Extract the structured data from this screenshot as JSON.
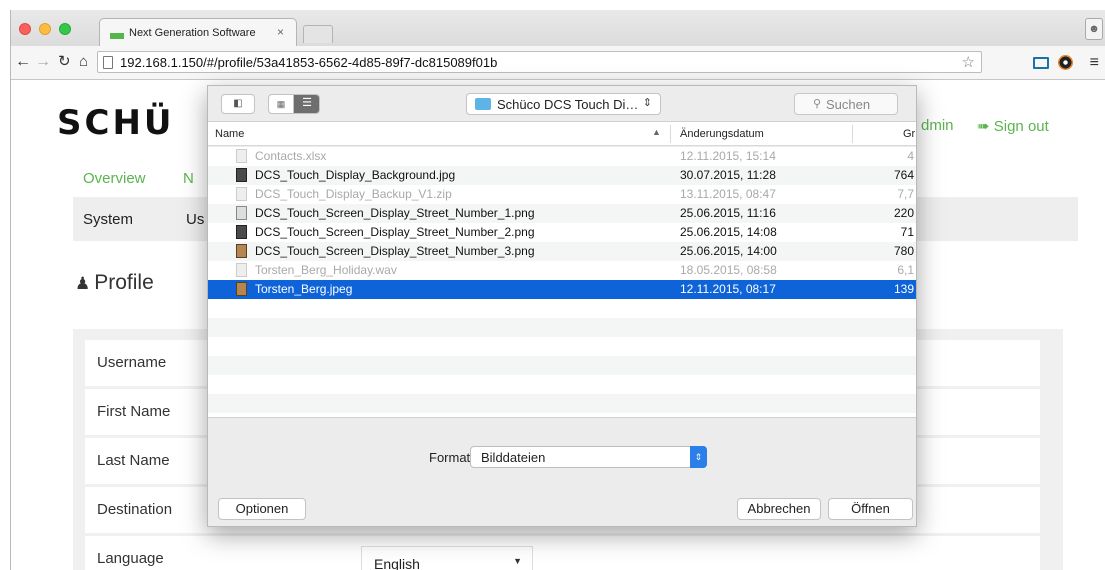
{
  "browser": {
    "tab_title": "Next Generation Software",
    "tab_close": "×",
    "url": "192.168.1.150/#/profile/53a41853-6562-4d85-89f7-dc815089f01b",
    "icons": [
      "back-arrow-icon",
      "forward-arrow-icon",
      "reload-icon",
      "home-icon",
      "page-icon",
      "star-icon",
      "extension-icon",
      "chrome-menu-icon",
      "profile-icon"
    ]
  },
  "page": {
    "logo": "SCHÜ",
    "admin_link": "dmin",
    "signout_label": "Sign out",
    "nav": {
      "overview": "Overview",
      "next": "N"
    },
    "subnav": {
      "system": "System",
      "users": "Us"
    },
    "profile_heading": "Profile",
    "form": {
      "username_label": "Username",
      "first_name_label": "First Name",
      "last_name_label": "Last Name",
      "destination_label": "Destination",
      "language_label": "Language",
      "language_value": "English"
    },
    "accent_color": "#5bb44e"
  },
  "dialog": {
    "location": "Schüco DCS Touch Di…",
    "search_placeholder": "Suchen",
    "columns": {
      "name": "Name",
      "date": "Änderungsdatum",
      "size": "Gr"
    },
    "files": [
      {
        "name": "Contacts.xlsx",
        "date": "12.11.2015, 15:14",
        "size": "4",
        "state": "disabled"
      },
      {
        "name": "DCS_Touch_Display_Background.jpg",
        "date": "30.07.2015, 11:28",
        "size": "764",
        "state": "enabled"
      },
      {
        "name": "DCS_Touch_Display_Backup_V1.zip",
        "date": "13.11.2015, 08:47",
        "size": "7,7",
        "state": "disabled"
      },
      {
        "name": "DCS_Touch_Screen_Display_Street_Number_1.png",
        "date": "25.06.2015, 11:16",
        "size": "220",
        "state": "enabled"
      },
      {
        "name": "DCS_Touch_Screen_Display_Street_Number_2.png",
        "date": "25.06.2015, 14:08",
        "size": "71",
        "state": "enabled"
      },
      {
        "name": "DCS_Touch_Screen_Display_Street_Number_3.png",
        "date": "25.06.2015, 14:00",
        "size": "780",
        "state": "enabled"
      },
      {
        "name": "Torsten_Berg_Holiday.wav",
        "date": "18.05.2015, 08:58",
        "size": "6,1",
        "state": "disabled"
      },
      {
        "name": "Torsten_Berg.jpeg",
        "date": "12.11.2015, 08:17",
        "size": "139",
        "state": "selected"
      }
    ],
    "format_label": "Format:",
    "format_value": "Bilddateien",
    "options_button": "Optionen",
    "cancel_button": "Abbrechen",
    "open_button": "Öffnen",
    "selection_color": "#0e63d8"
  }
}
